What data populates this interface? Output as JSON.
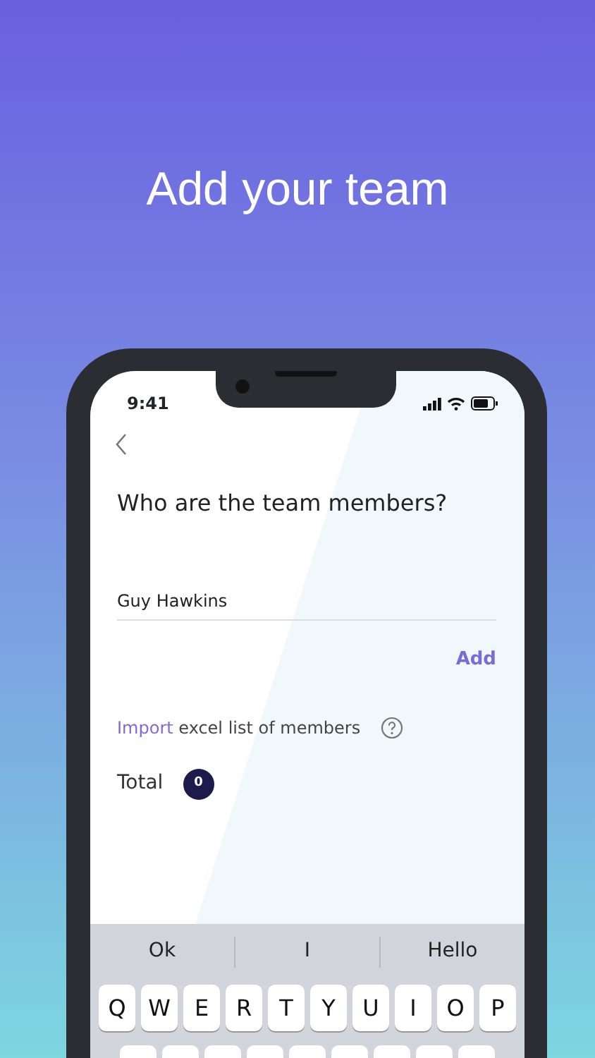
{
  "headline": "Add your team",
  "status_bar": {
    "time": "9:41"
  },
  "question": "Who are the team members?",
  "name_field": {
    "value": "Guy Hawkins"
  },
  "add_button": "Add",
  "import": {
    "link": "Import",
    "text": "excel list of members"
  },
  "total": {
    "label": "Total",
    "count": "0"
  },
  "keyboard": {
    "suggestions": [
      "Ok",
      "I",
      "Hello"
    ],
    "keys": [
      "Q",
      "W",
      "E",
      "R",
      "T",
      "Y",
      "U",
      "I",
      "O",
      "P"
    ]
  }
}
